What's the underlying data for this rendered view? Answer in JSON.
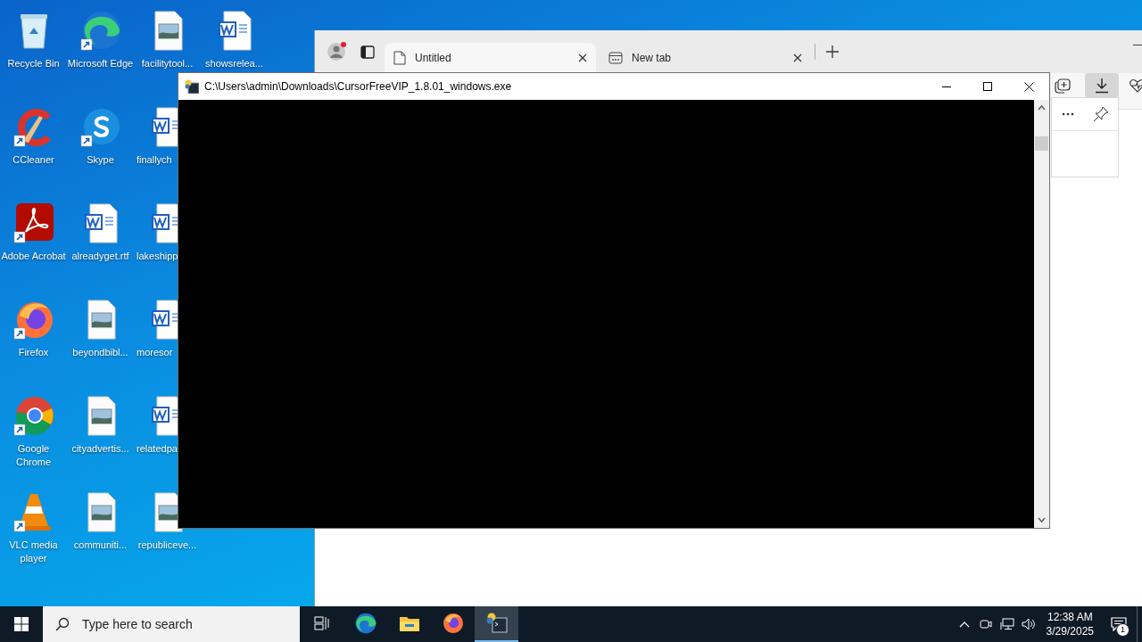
{
  "desktop": {
    "icons": [
      {
        "label": "Recycle Bin",
        "kind": "recycle",
        "shortcut": false,
        "covered": false
      },
      {
        "label": "CCleaner",
        "kind": "ccleaner",
        "shortcut": true,
        "covered": false
      },
      {
        "label": "Adobe Acrobat",
        "kind": "acrobat",
        "shortcut": true,
        "covered": false
      },
      {
        "label": "Firefox",
        "kind": "firefox",
        "shortcut": true,
        "covered": false
      },
      {
        "label": "Google Chrome",
        "kind": "chrome",
        "shortcut": true,
        "covered": false
      },
      {
        "label": "VLC media player",
        "kind": "vlc",
        "shortcut": true,
        "covered": false
      },
      {
        "label": "Microsoft Edge",
        "kind": "edge",
        "shortcut": true,
        "covered": false
      },
      {
        "label": "Skype",
        "kind": "skype",
        "shortcut": true,
        "covered": false
      },
      {
        "label": "alreadyget.rtf",
        "kind": "word",
        "shortcut": false,
        "covered": false
      },
      {
        "label": "beyondbibl...",
        "kind": "image",
        "shortcut": false,
        "covered": false
      },
      {
        "label": "cityadvertis...",
        "kind": "image",
        "shortcut": false,
        "covered": false
      },
      {
        "label": "communiti...",
        "kind": "image",
        "shortcut": false,
        "covered": false
      },
      {
        "label": "facilitytool...",
        "kind": "image",
        "shortcut": false,
        "covered": false
      },
      {
        "label": "finallych",
        "kind": "word",
        "shortcut": false,
        "covered": true
      },
      {
        "label": "lakeshipp",
        "kind": "word",
        "shortcut": false,
        "covered": true
      },
      {
        "label": "moresor",
        "kind": "word",
        "shortcut": false,
        "covered": true
      },
      {
        "label": "relatedpa",
        "kind": "word",
        "shortcut": false,
        "covered": true
      },
      {
        "label": "republiceve...",
        "kind": "image",
        "shortcut": false,
        "covered": false
      },
      {
        "label": "showsrelea...",
        "kind": "word",
        "shortcut": false,
        "covered": false
      }
    ]
  },
  "browser": {
    "tabs": [
      {
        "label": "Untitled",
        "kind": "page",
        "selected": true
      },
      {
        "label": "New tab",
        "kind": "newtab",
        "selected": false
      }
    ],
    "toolbar": [
      {
        "kind": "collections",
        "selected": false
      },
      {
        "kind": "downloads",
        "selected": true
      },
      {
        "kind": "health",
        "selected": false
      }
    ]
  },
  "console": {
    "title": "C:\\Users\\admin\\Downloads\\CursorFreeVIP_1.8.01_windows.exe"
  },
  "taskbar": {
    "search": {
      "placeholder": "Type here to search"
    },
    "apps": [
      {
        "kind": "taskview",
        "selected": false
      },
      {
        "kind": "edge",
        "selected": false
      },
      {
        "kind": "explorer",
        "selected": false
      },
      {
        "kind": "firefox",
        "selected": false
      },
      {
        "kind": "console",
        "selected": true
      }
    ],
    "clock": {
      "time": "12:38 AM",
      "date": "3/29/2025"
    },
    "notifications": {
      "count": "1"
    }
  }
}
